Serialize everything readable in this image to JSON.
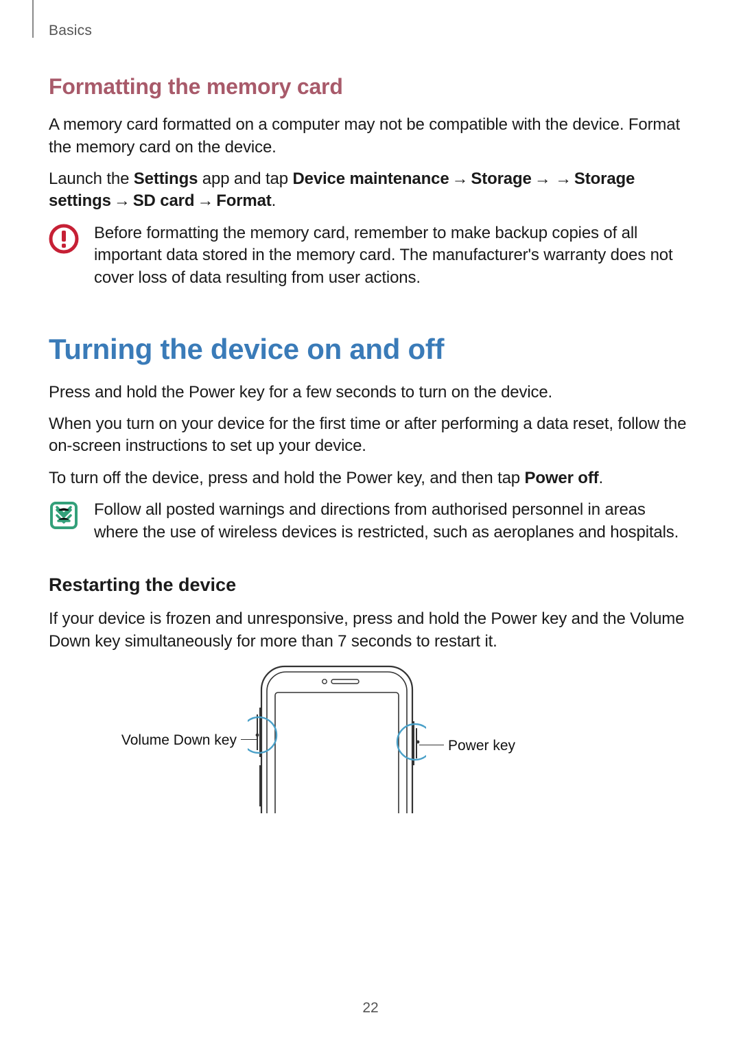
{
  "chapter": "Basics",
  "pageNumber": "22",
  "sec1": {
    "heading": "Formatting the memory card",
    "para1": "A memory card formatted on a computer may not be compatible with the device. Format the memory card on the device.",
    "instruction": {
      "lead": "Launch the ",
      "app": "Settings",
      "mid1": " app and tap ",
      "s1": "Device maintenance",
      "arrow": " → ",
      "s2": "Storage",
      "arrowGap": " →    → ",
      "s3": "Storage settings",
      "s4": "SD card",
      "s5": "Format",
      "period": "."
    },
    "warning": "Before formatting the memory card, remember to make backup copies of all important data stored in the memory card. The manufacturer's warranty does not cover loss of data resulting from user actions."
  },
  "sec2": {
    "heading": "Turning the device on and off",
    "para1": "Press and hold the Power key for a few seconds to turn on the device.",
    "para2": "When you turn on your device for the first time or after performing a data reset, follow the on-screen instructions to set up your device.",
    "para3": {
      "lead": "To turn off the device, press and hold the Power key, and then tap ",
      "bold": "Power off",
      "period": "."
    },
    "note": "Follow all posted warnings and directions from authorised personnel in areas where the use of wireless devices is restricted, such as aeroplanes and hospitals.",
    "sub": {
      "heading": "Restarting the device",
      "para": "If your device is frozen and unresponsive, press and hold the Power key and the Volume Down key simultaneously for more than 7 seconds to restart it."
    },
    "diagram": {
      "leftLabel": "Volume Down key",
      "rightLabel": "Power key"
    }
  }
}
